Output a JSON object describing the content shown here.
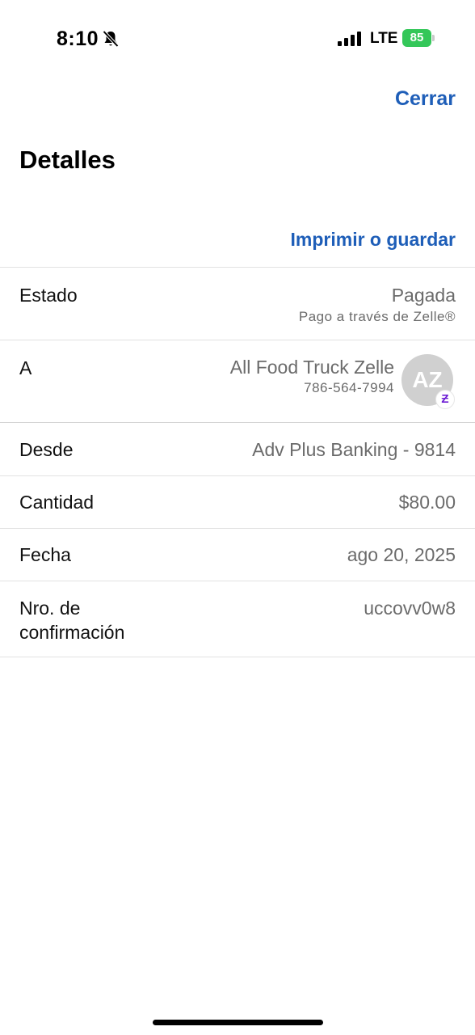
{
  "status_bar": {
    "time": "8:10",
    "network": "LTE",
    "battery_level": "85",
    "icons": [
      "bell-slash-icon",
      "cellular-signal-icon",
      "battery-charging-icon"
    ],
    "colors": {
      "battery": "#34c759"
    }
  },
  "header": {
    "close_label": "Cerrar",
    "title": "Detalles",
    "print_label": "Imprimir o guardar",
    "accent_color": "#1e5eb8"
  },
  "details": {
    "estado": {
      "label": "Estado",
      "value": "Pagada",
      "sub": "Pago a través de Zelle®"
    },
    "recipient": {
      "label": "A",
      "name": "All Food Truck Zelle",
      "phone": "786-564-7994",
      "avatar_initials": "AZ",
      "badge_glyph": "Ƶ",
      "badge_color": "#6d1ed4"
    },
    "desde": {
      "label": "Desde",
      "value": "Adv Plus Banking - 9814"
    },
    "cantidad": {
      "label": "Cantidad",
      "value": "$80.00"
    },
    "fecha": {
      "label": "Fecha",
      "value": "ago 20, 2025"
    },
    "confirmacion": {
      "label_line1": "Nro. de",
      "label_line2": "confirmación",
      "value": "uccovv0w8"
    }
  }
}
